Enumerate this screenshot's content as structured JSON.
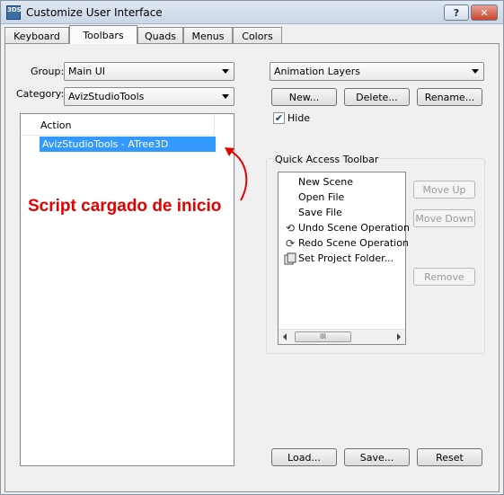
{
  "window": {
    "title": "Customize User Interface",
    "icon_text": "3DS",
    "help_label": "?",
    "close_label": "✕"
  },
  "tabs": [
    {
      "label": "Keyboard",
      "active": false
    },
    {
      "label": "Toolbars",
      "active": true
    },
    {
      "label": "Quads",
      "active": false
    },
    {
      "label": "Menus",
      "active": false
    },
    {
      "label": "Colors",
      "active": false
    }
  ],
  "left": {
    "group_label": "Group:",
    "group_value": "Main UI",
    "category_label": "Category:",
    "category_value": "AvizStudioTools",
    "action_header": "Action",
    "selected_action": "AvizStudioTools - ATree3D"
  },
  "annotation": {
    "text": "Script cargado de inicio",
    "color": "#e50000"
  },
  "right": {
    "toolbar_value": "Animation Layers",
    "new_label": "New...",
    "delete_label": "Delete...",
    "rename_label": "Rename...",
    "hide_label": "Hide",
    "hide_checked": true,
    "quick_access_title": "Quick Access Toolbar",
    "quick_access_items": [
      {
        "label": "New Scene",
        "icon": "none"
      },
      {
        "label": "Open File",
        "icon": "none"
      },
      {
        "label": "Save File",
        "icon": "none"
      },
      {
        "label": "Undo Scene Operation",
        "icon": "undo-icon"
      },
      {
        "label": "Redo Scene Operation",
        "icon": "redo-icon"
      },
      {
        "label": "Set Project Folder...",
        "icon": "project-folder-icon"
      }
    ],
    "scroll_thumb_label": "III",
    "move_up_label": "Move Up",
    "move_down_label": "Move Down",
    "remove_label": "Remove"
  },
  "footer": {
    "load_label": "Load...",
    "save_label": "Save...",
    "reset_label": "Reset"
  },
  "colors": {
    "selection": "#3399ff"
  }
}
